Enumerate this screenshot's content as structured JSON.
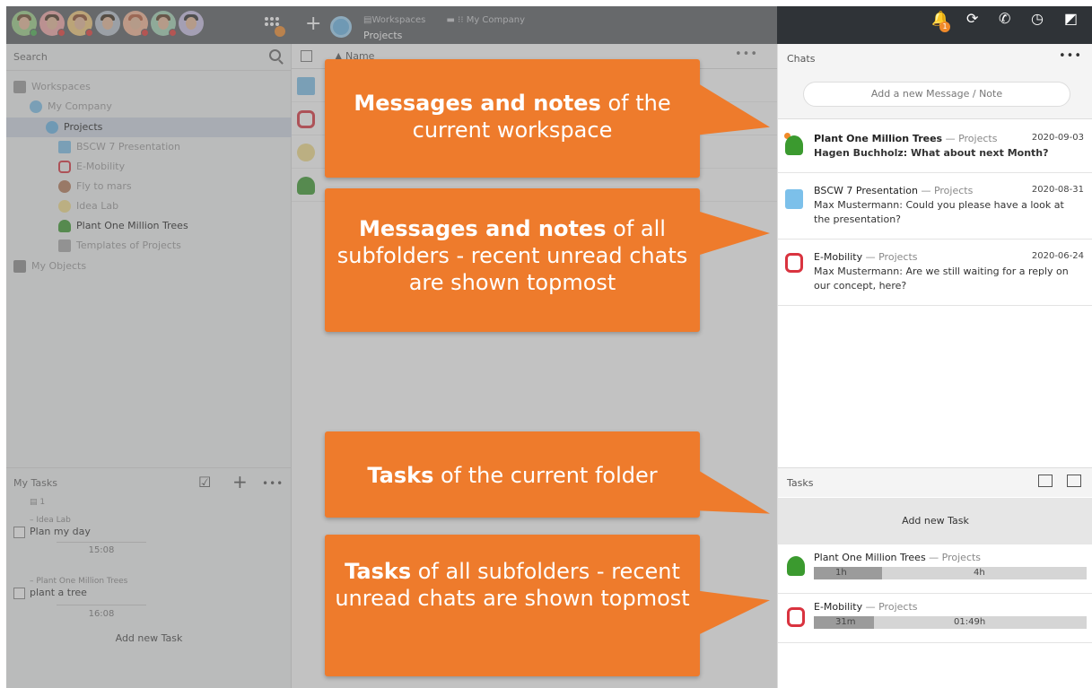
{
  "topbar": {
    "crumb_workspaces": "Workspaces",
    "crumb_company": "My Company",
    "current": "Projects",
    "notification_count": "1"
  },
  "left": {
    "search_label": "Search",
    "tree": [
      {
        "label": "Workspaces"
      },
      {
        "label": "My Company"
      },
      {
        "label": "Projects"
      },
      {
        "label": "BSCW 7 Presentation"
      },
      {
        "label": "E-Mobility"
      },
      {
        "label": "Fly to mars"
      },
      {
        "label": "Idea Lab"
      },
      {
        "label": "Plant One Million Trees"
      },
      {
        "label": "Templates of Projects"
      },
      {
        "label": "My Objects"
      }
    ],
    "tasks_title": "My Tasks",
    "tasks": [
      {
        "count": "1",
        "context": "– Idea Lab",
        "name": "Plan my day",
        "time": "15:08"
      },
      {
        "context": "– Plant One Million Trees",
        "name": "plant a tree",
        "time": "16:08"
      }
    ],
    "add_task": "Add new Task"
  },
  "middle": {
    "column_name": "Name"
  },
  "right": {
    "chats_title": "Chats",
    "message_placeholder": "Add a new Message / Note",
    "chats": [
      {
        "title": "Plant One Million Trees",
        "context": "— Projects",
        "date": "2020-09-03",
        "body": "Hagen Buchholz: What about next Month?",
        "unread": true
      },
      {
        "title": "BSCW 7 Presentation",
        "context": "— Projects",
        "date": "2020-08-31",
        "body": "Max Mustermann: Could you please have a look at the presentation?",
        "unread": false
      },
      {
        "title": "E-Mobility",
        "context": "— Projects",
        "date": "2020-06-24",
        "body": "Max Mustermann: Are we still waiting for a reply on our concept, here?",
        "unread": false
      }
    ],
    "tasks_title": "Tasks",
    "add_task": "Add new Task",
    "tasks": [
      {
        "title": "Plant One Million Trees",
        "context": "— Projects",
        "spent": "1h",
        "estimate": "4h",
        "progress": 0.25
      },
      {
        "title": "E-Mobility",
        "context": "— Projects",
        "spent": "31m",
        "estimate": "01:49h",
        "progress": 0.22
      }
    ]
  },
  "callouts": {
    "c1_bold": "Messages and notes",
    "c1_rest": " of the current workspace",
    "c2_bold": "Messages and notes",
    "c2_rest": " of all subfolders - recent unread chats are shown topmost",
    "c3_bold": "Tasks",
    "c3_rest": " of the current folder",
    "c4_bold": "Tasks",
    "c4_rest": " of all subfolders - recent unread chats are shown topmost"
  },
  "colors": {
    "accent": "#ee7b2c",
    "topbar": "#5a5d61",
    "topbar_right": "#2f3337",
    "selection": "#cfd8e3"
  }
}
